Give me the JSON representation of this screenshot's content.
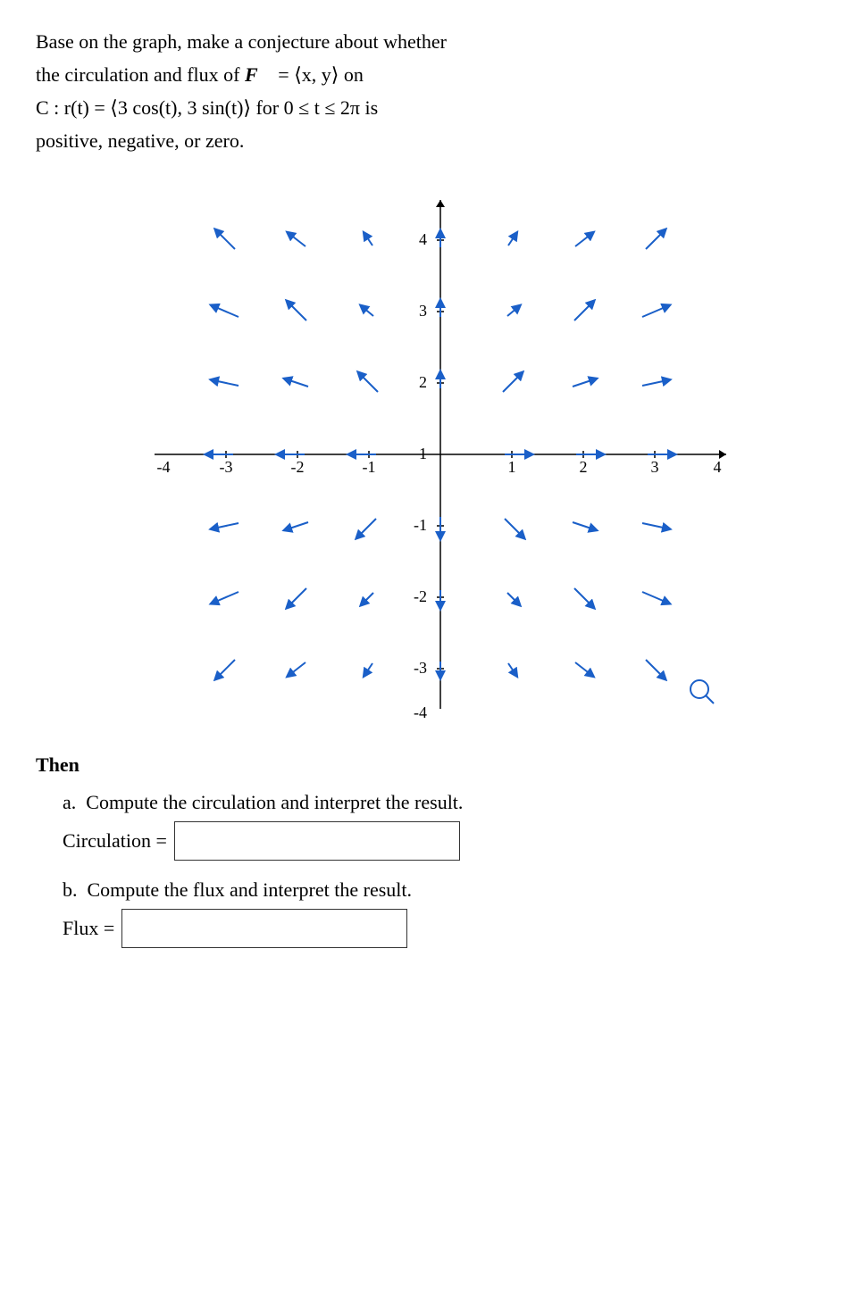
{
  "header": {
    "line1": "Base on the graph, make a conjecture about whether",
    "line2": "the circulation and flux of ",
    "F_vector": "F",
    "equals": " = ⟨x, y⟩ on",
    "line3": "C : r(t) = ⟨3 cos(t), 3 sin(t)⟩ for 0 ≤ t ≤ 2π is",
    "line4": "positive, negative, or zero."
  },
  "then_label": "Then",
  "parts": {
    "a": {
      "label": "a.",
      "text": "Compute the circulation and interpret the result.",
      "answer_label": "Circulation =",
      "answer_value": ""
    },
    "b": {
      "label": "b.",
      "text": "Compute the flux and interpret the result.",
      "answer_label": "Flux =",
      "answer_value": ""
    }
  },
  "graph": {
    "axis_color": "#000",
    "arrow_color": "#1a5fc8",
    "x_labels": [
      "-4",
      "-3",
      "-2",
      "-1",
      "1",
      "2",
      "3",
      "4"
    ],
    "y_labels": [
      "-4",
      "-3",
      "-2",
      "-1",
      "1",
      "2",
      "3",
      "4"
    ]
  }
}
